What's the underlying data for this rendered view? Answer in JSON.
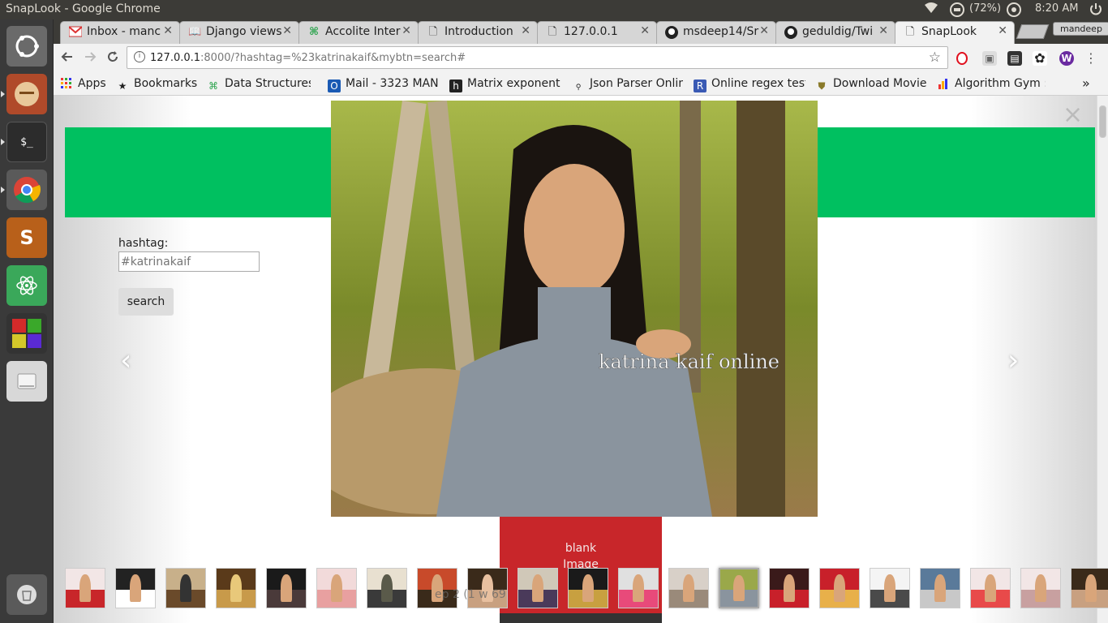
{
  "os_panel": {
    "window_title": "SnapLook - Google Chrome",
    "battery": "(72%)",
    "clock": "8:20 AM",
    "icons": [
      "wifi-icon",
      "battery-icon",
      "sound-icon",
      "power-icon"
    ]
  },
  "launcher": {
    "items": [
      "ubuntu-dash-icon",
      "files-icon",
      "terminal-icon",
      "chrome-icon",
      "sublime-text-icon",
      "atom-icon",
      "workspaces-icon",
      "drive-icon",
      "trash-icon"
    ]
  },
  "browser": {
    "tabs": [
      {
        "label": "Inbox - manc",
        "icon": "gmail-icon"
      },
      {
        "label": "Django views",
        "icon": "book-icon"
      },
      {
        "label": "Accolite Inter",
        "icon": "hackerrank-icon"
      },
      {
        "label": "Introduction",
        "icon": "page-icon"
      },
      {
        "label": "127.0.0.1",
        "icon": "page-icon"
      },
      {
        "label": "msdeep14/Sr",
        "icon": "github-icon"
      },
      {
        "label": "geduldig/Twi",
        "icon": "github-icon"
      },
      {
        "label": "SnapLook",
        "icon": "page-icon"
      }
    ],
    "profile_name": "mandeep",
    "address": {
      "host": "127.0.0.1",
      "rest": ":8000/?hashtag=%23katrinakaif&mybtn=search#"
    },
    "bookmarks": [
      {
        "label": "Apps",
        "icon": "apps-grid-icon"
      },
      {
        "label": "Bookmarks",
        "icon": "star-icon"
      },
      {
        "label": "Data Structures",
        "icon": "hackerrank-icon"
      },
      {
        "label": "Mail - 3323 MAN",
        "icon": "outlook-icon"
      },
      {
        "label": "Matrix exponenti",
        "icon": "h-icon"
      },
      {
        "label": "Json Parser Onlin",
        "icon": "json-icon"
      },
      {
        "label": "Online regex test",
        "icon": "r-icon"
      },
      {
        "label": "Download Movie",
        "icon": "shield-icon"
      },
      {
        "label": "Algorithm Gym ::",
        "icon": "chart-icon"
      }
    ],
    "overflow": "»",
    "extension_icons": [
      "opera-icon",
      "screenshot-icon",
      "film-icon",
      "extension-icon",
      "w-icon",
      "menu-icon"
    ]
  },
  "page": {
    "form": {
      "label": "hashtag:",
      "placeholder": "#katrinakaif",
      "button": "search"
    },
    "lightbox": {
      "close": "×",
      "prev": "‹",
      "next": "›",
      "watermark": "katrina kaif online",
      "caption_line1": "blank",
      "caption_line2": "Image",
      "faint_text": "ep 2 (1 w 69"
    },
    "thumbnail_count": 21,
    "selected_thumbnail": 13,
    "colors": {
      "banner": "#00c060",
      "caption_bg": "#c8262a"
    }
  }
}
